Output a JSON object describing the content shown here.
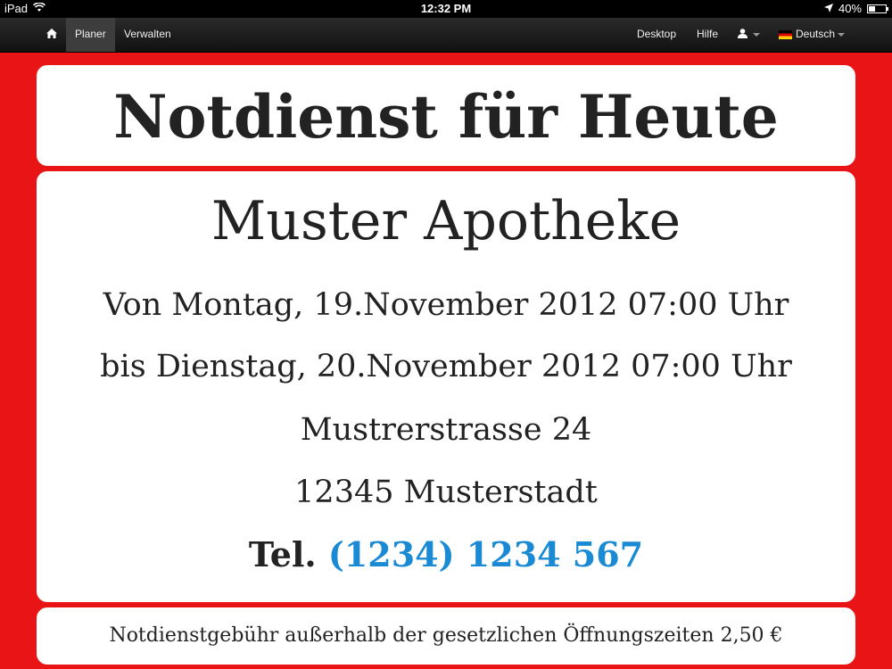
{
  "status_bar": {
    "device": "iPad",
    "time": "12:32 PM",
    "battery": "40%",
    "battery_level": 0.4
  },
  "navbar": {
    "home_icon": "home-icon",
    "items": [
      "Planer",
      "Verwalten"
    ],
    "active_item": "Planer",
    "right_items": {
      "desktop": "Desktop",
      "help": "Hilfe",
      "user_icon": "user-icon",
      "language": "Deutsch"
    }
  },
  "main": {
    "title": "Notdienst für Heute",
    "pharmacy": {
      "name": "Muster Apotheke",
      "from": "Von Montag, 19.November 2012 07:00 Uhr",
      "to": "bis Dienstag, 20.November 2012 07:00 Uhr",
      "street": "Mustrerstrasse 24",
      "city": "12345 Musterstadt",
      "tel_label": "Tel.",
      "tel_number": "(1234) 1234 567"
    },
    "fee_note": "Notdienstgebühr außerhalb der gesetzlichen Öffnungszeiten 2,50 €"
  },
  "colors": {
    "background": "#e81416",
    "link": "#1a8ad4",
    "card": "#ffffff"
  }
}
